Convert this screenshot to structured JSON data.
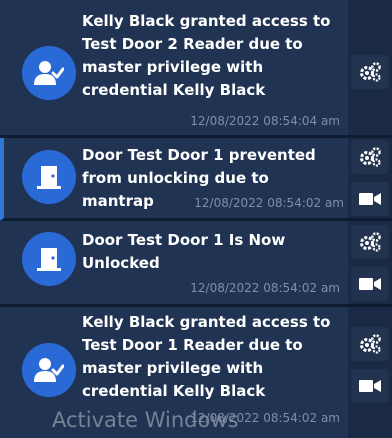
{
  "events": [
    {
      "message": "Kelly Black granted access to Test Door 2 Reader due to master privilege with credential Kelly Black",
      "timestamp": "12/08/2022 08:54:04 am",
      "icon": "user-check-icon",
      "actions": [
        "gears-icon"
      ]
    },
    {
      "message": "Door Test Door 1 prevented from unlocking due to mantrap",
      "timestamp": "12/08/2022 08:54:02 am",
      "icon": "door-icon",
      "actions": [
        "gears-icon",
        "video-camera-icon"
      ]
    },
    {
      "message": "Door Test Door 1 Is Now Unlocked",
      "timestamp": "12/08/2022 08:54:02 am",
      "icon": "door-icon",
      "actions": [
        "gears-icon",
        "video-camera-icon"
      ]
    },
    {
      "message": "Kelly Black granted access to Test Door 1 Reader due to master privilege with credential Kelly Black",
      "timestamp": "12/08/2022 08:54:02 am",
      "icon": "user-check-icon",
      "actions": [
        "gears-icon",
        "video-camera-icon"
      ]
    }
  ],
  "watermark": "Activate Windows",
  "colors": {
    "background": "#1b2a45",
    "card": "#213352",
    "avatar": "#2a6ad6",
    "timestamp": "#7e8ea8",
    "selected_accent": "#2d78d0"
  }
}
